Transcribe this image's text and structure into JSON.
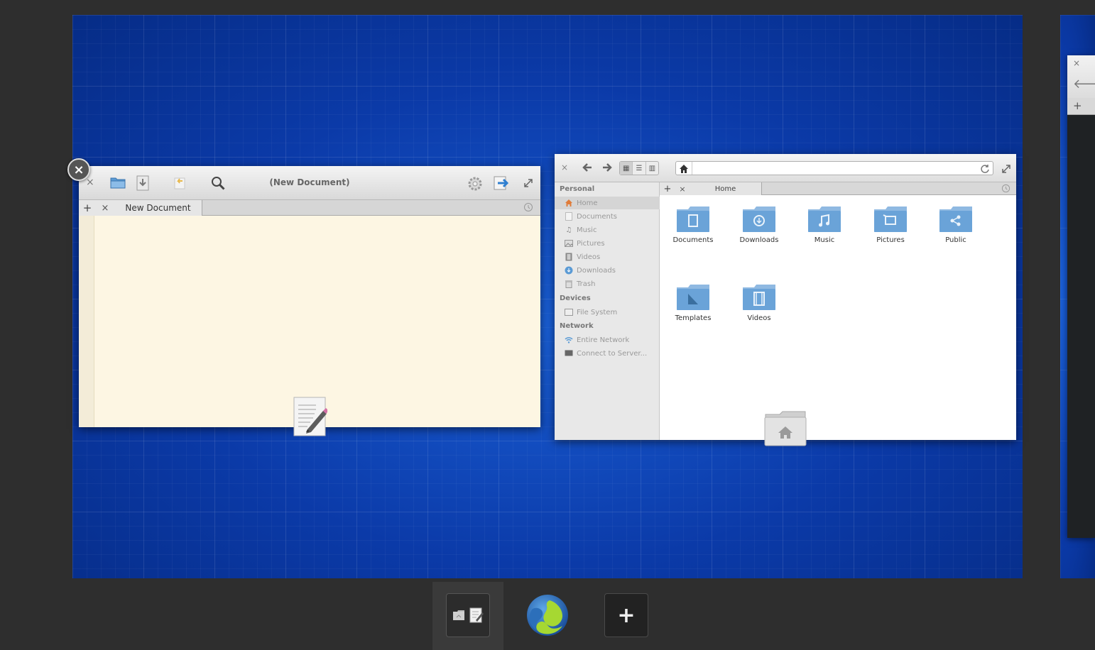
{
  "editor": {
    "title": "(New Document)",
    "tab_label": "New Document",
    "tab_close": "×",
    "tab_add": "+",
    "close": "×"
  },
  "files": {
    "sidebar": {
      "personal_heading": "Personal",
      "personal_items": [
        "Home",
        "Documents",
        "Music",
        "Pictures",
        "Videos",
        "Downloads",
        "Trash"
      ],
      "devices_heading": "Devices",
      "devices_items": [
        "File System"
      ],
      "network_heading": "Network",
      "network_items": [
        "Entire Network",
        "Connect to Server..."
      ]
    },
    "tab_label": "Home",
    "tab_close": "×",
    "tab_add": "+",
    "close": "×",
    "folders": [
      "Documents",
      "Downloads",
      "Music",
      "Pictures",
      "Public",
      "Templates",
      "Videos"
    ]
  },
  "window_close_bubble": "×",
  "peek": {
    "close": "×",
    "plus": "+"
  },
  "dock": {
    "add_label": "+"
  },
  "colors": {
    "workspace": "#0a3fb0",
    "folder": "#6aa3d8",
    "editor_bg": "#fdf6e3"
  }
}
